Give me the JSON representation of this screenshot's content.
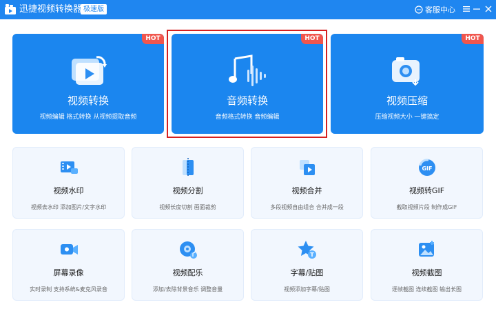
{
  "app": {
    "title": "迅捷视频转换器",
    "edition": "极速版",
    "service_label": "客服中心",
    "accent_color": "#1f86f0",
    "hot_color": "#f0564d"
  },
  "big_cards": [
    {
      "title": "视频转换",
      "desc": "视频编辑 格式转换 从视频提取音频",
      "badge": "HOT",
      "icon": "video-convert-icon"
    },
    {
      "title": "音频转换",
      "desc": "音频格式转换 音频编辑",
      "badge": "HOT",
      "icon": "audio-convert-icon",
      "highlighted": true
    },
    {
      "title": "视频压缩",
      "desc": "压缩视频大小 一键搞定",
      "badge": "HOT",
      "icon": "video-compress-icon"
    }
  ],
  "tools": [
    {
      "title": "视频水印",
      "desc": "视频去水印 添加图片/文字水印",
      "icon": "watermark-icon"
    },
    {
      "title": "视频分割",
      "desc": "视频长度切割 画面裁剪",
      "icon": "split-icon"
    },
    {
      "title": "视频合并",
      "desc": "多段视频自由组合 合并成一段",
      "icon": "merge-icon"
    },
    {
      "title": "视频转GIF",
      "desc": "截取视频片段 制作成GIF",
      "icon": "gif-icon"
    },
    {
      "title": "屏幕录像",
      "desc": "实时录制 支持系统&麦克风录音",
      "icon": "screen-record-icon"
    },
    {
      "title": "视频配乐",
      "desc": "添加/去除背景音乐 调整音量",
      "icon": "music-icon"
    },
    {
      "title": "字幕/贴图",
      "desc": "视频添加字幕/贴图",
      "icon": "subtitle-icon"
    },
    {
      "title": "视频截图",
      "desc": "逐帧截图 连续截图 输出长图",
      "icon": "screenshot-icon"
    }
  ]
}
